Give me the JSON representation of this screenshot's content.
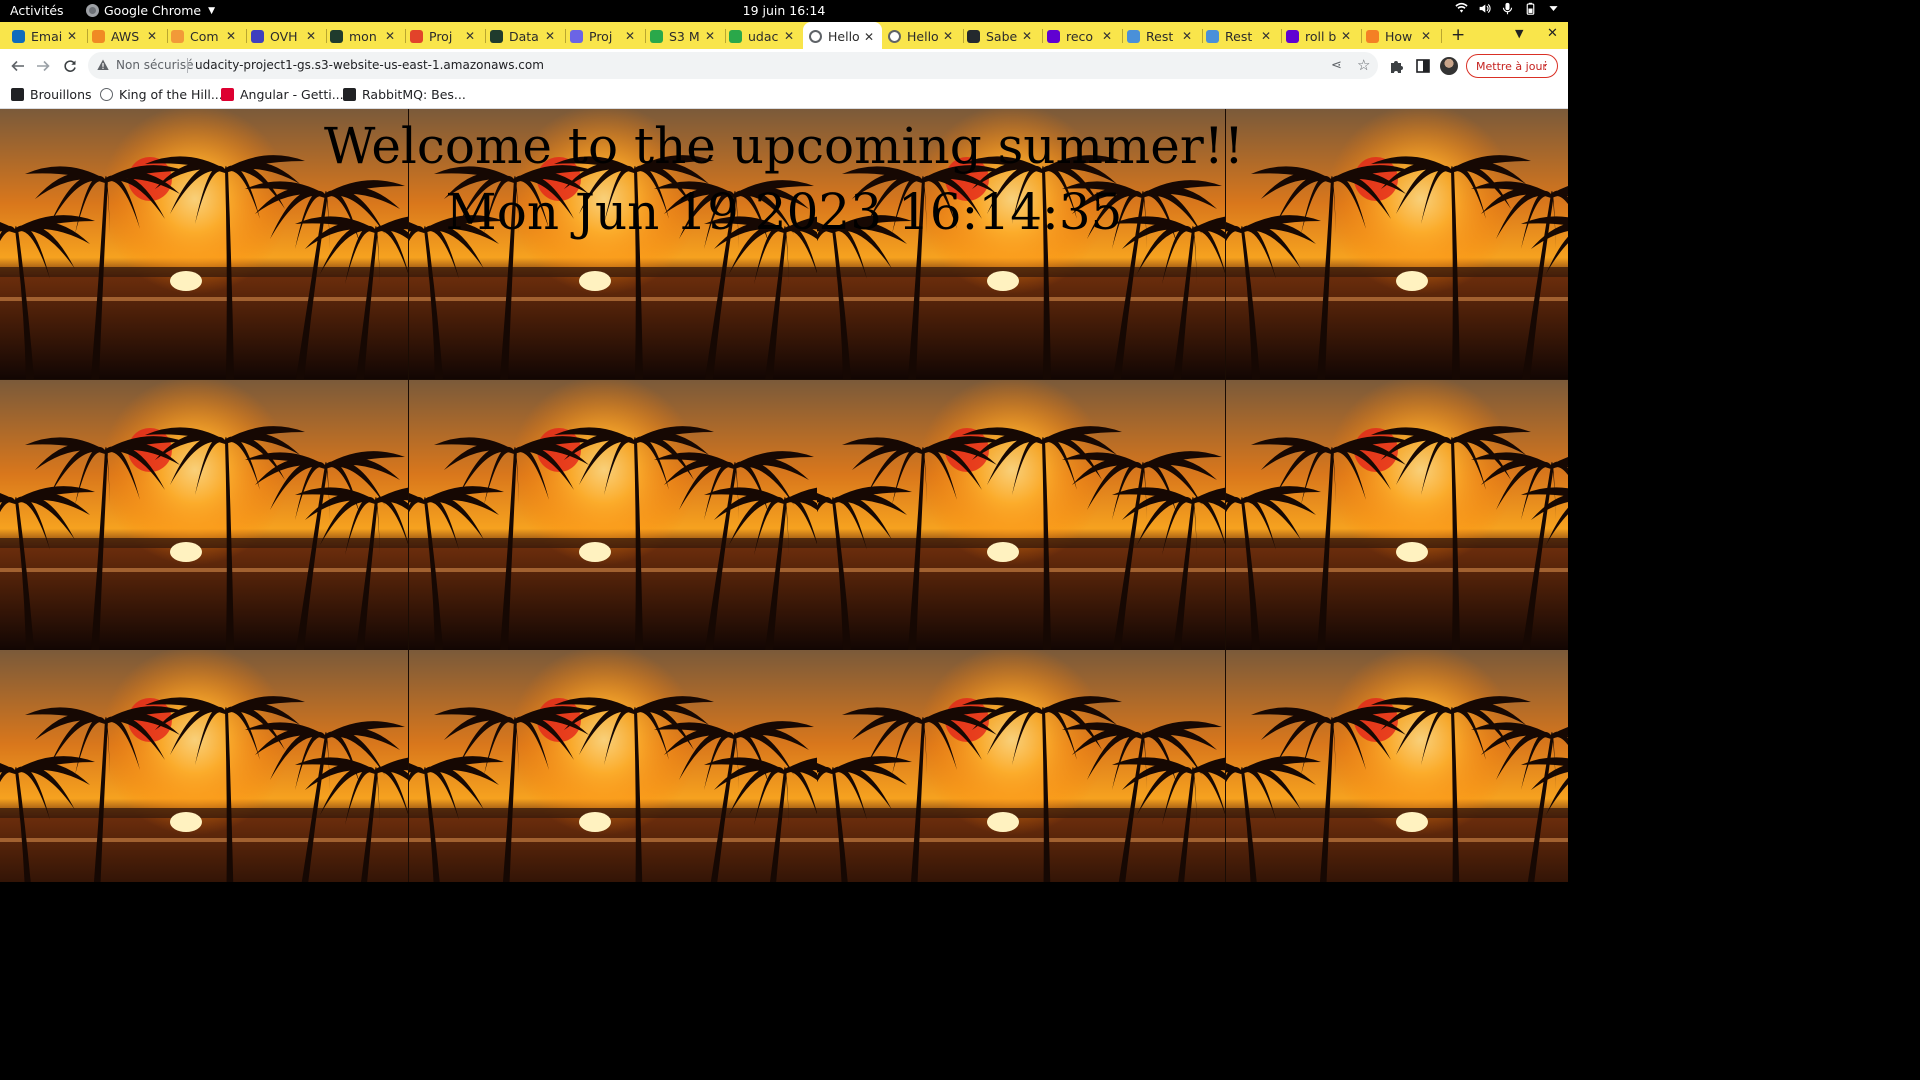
{
  "system_bar": {
    "activities": "Activités",
    "app_name": "Google Chrome",
    "clock": "19 juin 16:14"
  },
  "tabs": [
    {
      "title": "Emai",
      "favicon": "outlook-icon",
      "color": "#0f6cbd"
    },
    {
      "title": "AWS",
      "favicon": "aws-icon",
      "color": "#f08a24"
    },
    {
      "title": "Com",
      "favicon": "compute-icon",
      "color": "#f29a38"
    },
    {
      "title": "OVH",
      "favicon": "ovh-icon",
      "color": "#3f3fbf"
    },
    {
      "title": "mon",
      "favicon": "mongodb-icon",
      "color": "#1f3b2d"
    },
    {
      "title": "Proj",
      "favicon": "gitlab-icon",
      "color": "#e2432a"
    },
    {
      "title": "Data",
      "favicon": "mongodb-icon",
      "color": "#1f3b2d"
    },
    {
      "title": "Proj",
      "favicon": "udacity-icon",
      "color": "#6b64e6"
    },
    {
      "title": "S3 M",
      "favicon": "s3-icon",
      "color": "#2aa84a"
    },
    {
      "title": "udac",
      "favicon": "s3-icon",
      "color": "#2aa84a"
    },
    {
      "title": "Hello",
      "favicon": "globe-icon",
      "color": "#5f6368",
      "active": true
    },
    {
      "title": "Hello",
      "favicon": "globe-icon",
      "color": "#5f6368"
    },
    {
      "title": "Sabe",
      "favicon": "github-icon",
      "color": "#24292e"
    },
    {
      "title": "reco",
      "favicon": "yahoo-icon",
      "color": "#6001d2"
    },
    {
      "title": "Rest",
      "favicon": "docs-icon",
      "color": "#4a90d9"
    },
    {
      "title": "Rest",
      "favicon": "docs-icon",
      "color": "#4a90d9"
    },
    {
      "title": "roll b",
      "favicon": "yahoo-icon",
      "color": "#6001d2"
    },
    {
      "title": "How",
      "favicon": "stackoverflow-icon",
      "color": "#f48024"
    }
  ],
  "toolbar": {
    "security_label": "Non sécurisé",
    "url": "udacity-project1-gs.s3-website-us-east-1.amazonaws.com",
    "update_label": "Mettre à jour"
  },
  "bookmarks": [
    {
      "label": "Brouillons",
      "icon": "drafts-icon",
      "color": "#202124"
    },
    {
      "label": "King of the Hill...",
      "icon": "history-icon",
      "color": "#5f6368"
    },
    {
      "label": "Angular - Getti...",
      "icon": "angular-icon",
      "color": "#dd0031"
    },
    {
      "label": "RabbitMQ: Bes...",
      "icon": "rabbitmq-icon",
      "color": "#202124"
    }
  ],
  "page": {
    "heading": "Welcome to the upcoming summer!!",
    "datetime": "Mon Jun 19 2023 16:14:35"
  },
  "colors": {
    "tab_strip": "#f9e54b",
    "sky_top": "#7a5a3a",
    "sun": "#ffe08a",
    "palm": "#160803"
  }
}
